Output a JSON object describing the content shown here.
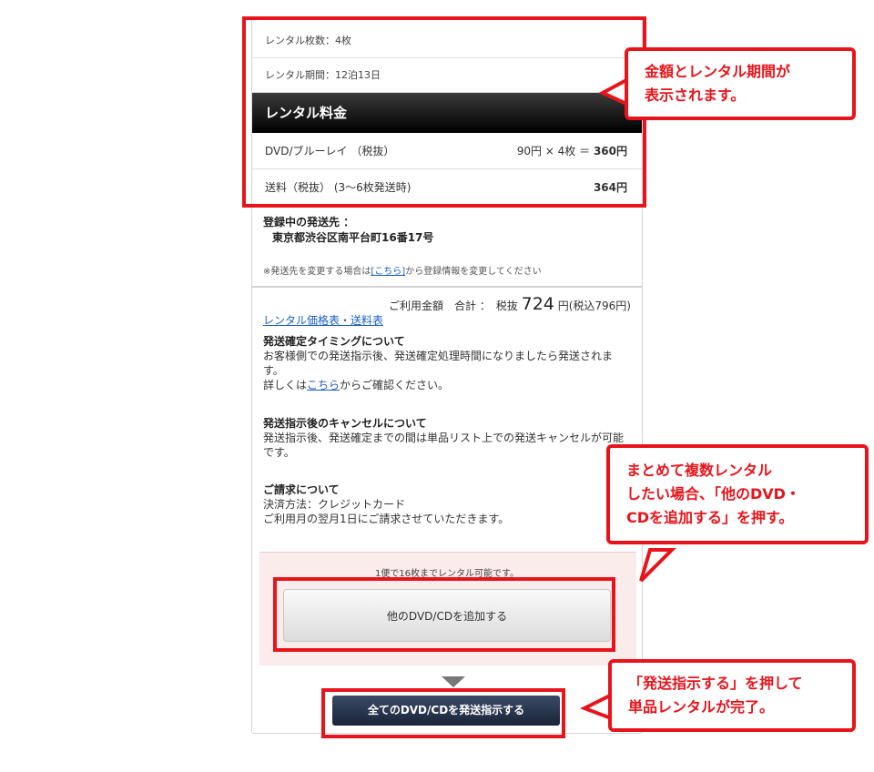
{
  "rental_info": {
    "count": "レンタル枚数：4枚",
    "period": "レンタル期間：12泊13日"
  },
  "fee": {
    "header": "レンタル料金",
    "dvd_label": "DVD/ブルーレイ （税抜）",
    "dvd_calc": "90円 × 4枚 ＝",
    "dvd_total": "360円",
    "ship_label": "送料（税抜） (3～6枚発送時)",
    "ship_total": "364円"
  },
  "address": {
    "title": "登録中の発送先 ：",
    "value": "東京都渋谷区南平台町16番17号",
    "note_prefix": "※発送先を変更する場合は",
    "note_link": "[こちら]",
    "note_suffix": "から登録情報を変更してください"
  },
  "total": {
    "prefix": "ご利用金額　合計 ：　税抜",
    "amount": "724",
    "suffix": "円(税込796円)"
  },
  "price_link": "レンタル価格表・送料表",
  "sections": {
    "timing_title": "発送確定タイミングについて",
    "timing_body": "お客様側での発送指示後、発送確定処理時間になりましたら発送されます。",
    "timing_detail_prefix": "詳しくは",
    "timing_detail_link": "こちら",
    "timing_detail_suffix": "からご確認ください。",
    "cancel_title": "発送指示後のキャンセルについて",
    "cancel_body": "発送指示後、発送確定までの間は単品リスト上での発送キャンセルが可能です。",
    "billing_title": "ご請求について",
    "billing_method": "決済方法：クレジットカード",
    "billing_body": "ご利用月の翌月1日にご請求させていただきます。"
  },
  "add_area": {
    "note": "1便で16枚までレンタル可能です。",
    "button": "他のDVD/CDを追加する"
  },
  "send_button": "全てのDVD/CDを発送指示する",
  "callouts": {
    "c1_line1": "金額とレンタル期間が",
    "c1_line2": "表示されます。",
    "c2_line1": "まとめて複数レンタル",
    "c2_line2": "したい場合、「他のDVD・",
    "c2_line3": "CDを追加する」を押す。",
    "c3_line1": "「発送指示する」を押して",
    "c3_line2": "単品レンタルが完了。"
  },
  "colors": {
    "accent_red": "#e8141b",
    "link_blue": "#1a5ec9",
    "header_black": "#000000",
    "send_button_navy": "#1a2438"
  }
}
